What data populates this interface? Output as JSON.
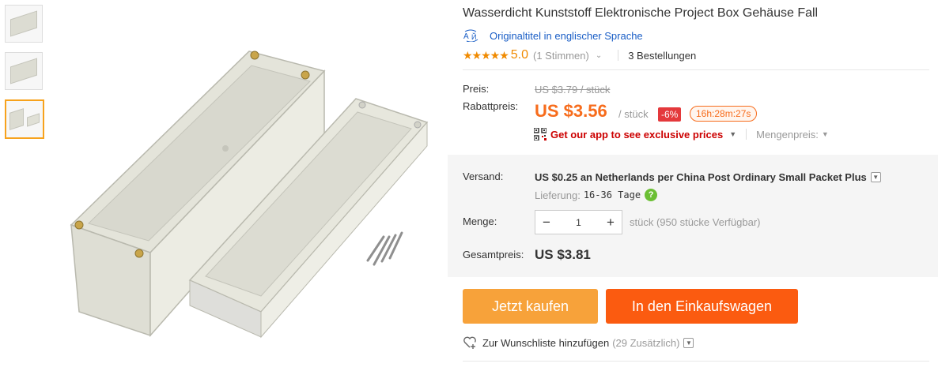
{
  "thumbnails": [
    {
      "name": "thumbnail-1"
    },
    {
      "name": "thumbnail-2"
    },
    {
      "name": "thumbnail-3",
      "active": true
    }
  ],
  "product": {
    "title": "Wasserdicht Kunststoff Elektronische Project Box Gehäuse Fall",
    "original_title_link": "Originaltitel in englischer Sprache",
    "stars": "★★★★★",
    "rating": "5.0",
    "votes": "(1 Stimmen)",
    "orders": "3 Bestellungen"
  },
  "pricing": {
    "price_label": "Preis:",
    "old_price": "US $3.79 / stück",
    "discount_label": "Rabattpreis:",
    "price": "US $3.56",
    "unit": "/ stück",
    "discount_badge": "-6%",
    "timer": "16h:28m:27s",
    "app_promo": "Get our app to see exclusive prices",
    "quantity_price": "Mengenpreis:"
  },
  "shipping": {
    "label": "Versand:",
    "value": "US $0.25 an Netherlands per China Post Ordinary Small Packet Plus",
    "delivery_label": "Lieferung:",
    "delivery_days": "16-36 Tage"
  },
  "quantity": {
    "label": "Menge:",
    "minus": "−",
    "value": "1",
    "plus": "+",
    "availability": "stück (950 stücke Verfügbar)"
  },
  "total": {
    "label": "Gesamtpreis:",
    "value": "US $3.81"
  },
  "actions": {
    "buy_now": "Jetzt kaufen",
    "add_to_cart": "In den Einkaufswagen",
    "wishlist": "Zur Wunschliste hinzufügen",
    "wishlist_count": "(29 Zusätzlich)"
  },
  "colors": {
    "accent_orange": "#f76c1c",
    "buy_now_bg": "#f7a23a",
    "cart_bg": "#fb5b10",
    "link_blue": "#1a5ec6",
    "promo_red": "#cc0000"
  }
}
